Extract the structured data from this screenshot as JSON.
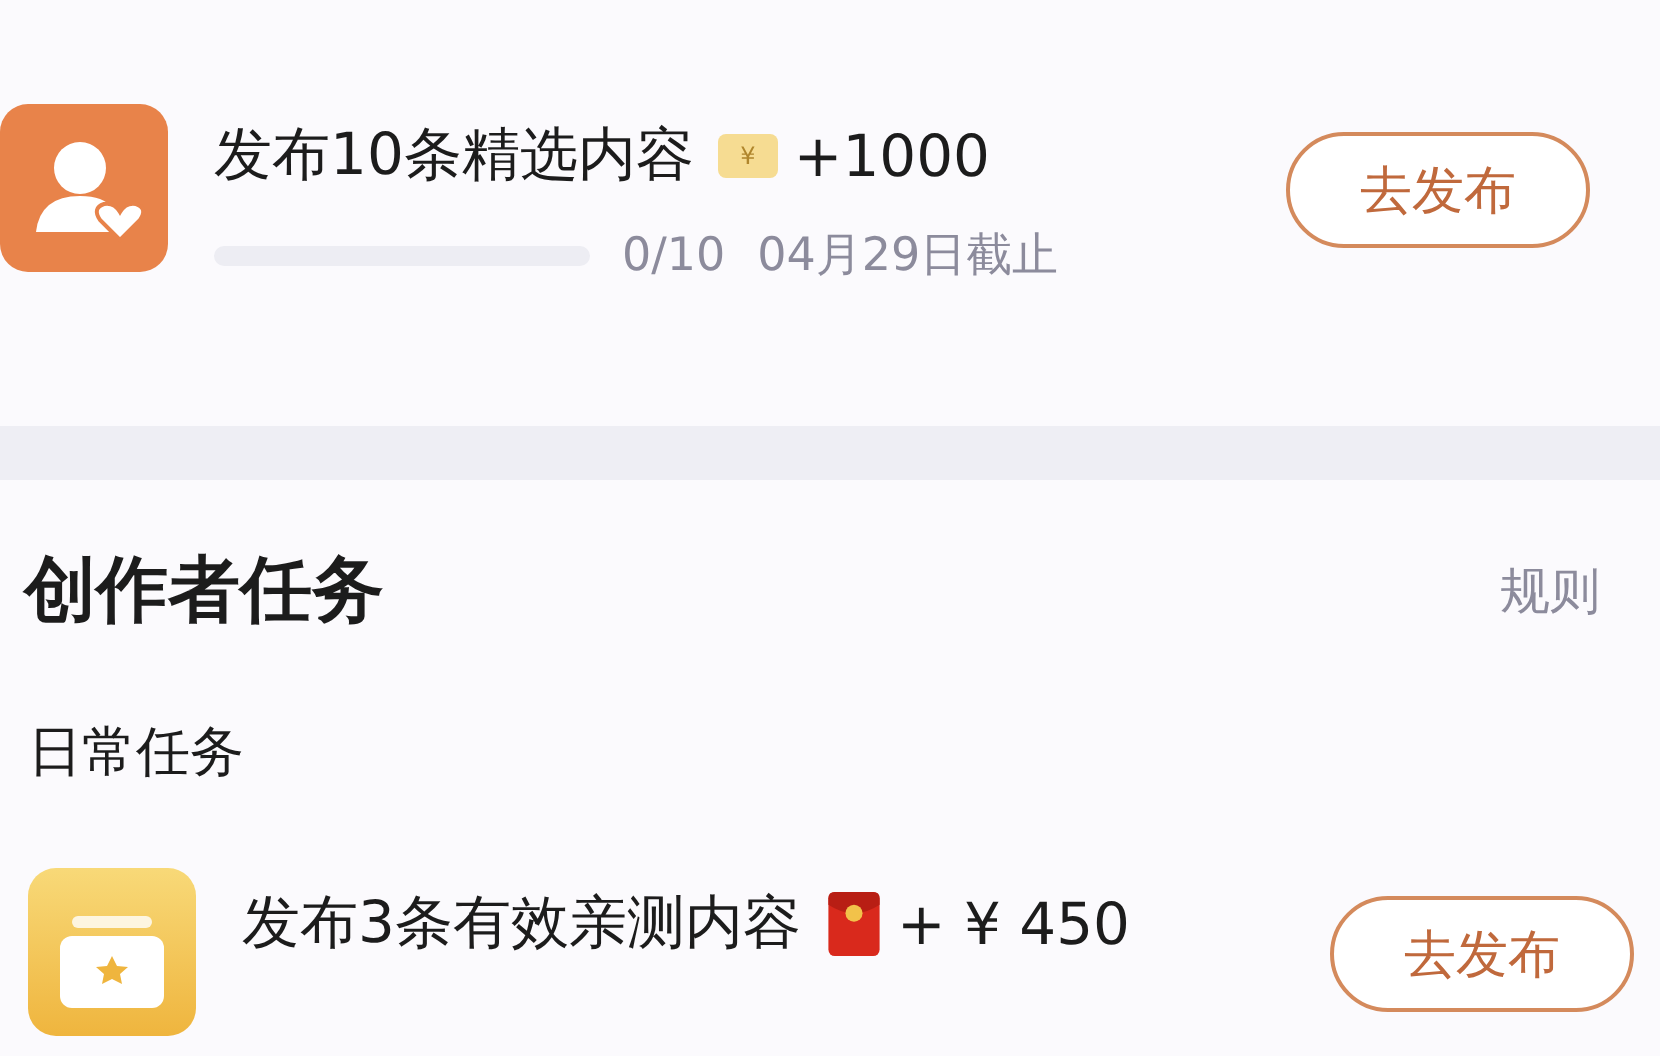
{
  "top_task": {
    "title": "发布10条精选内容",
    "reward": {
      "kind": "coin",
      "icon_text": "¥",
      "amount": "+1000"
    },
    "level": 0,
    "progress": "0/10",
    "deadline": "04月29日截止",
    "button": "去发布"
  },
  "section": {
    "title": "创作者任务",
    "rules_link": "规则",
    "subtitle": "日常任务",
    "tasks": [
      {
        "title": "发布3条有效亲测内容",
        "reward": {
          "kind": "red-packet",
          "amount": "+ ¥ 450"
        },
        "button": "去发布"
      }
    ]
  }
}
